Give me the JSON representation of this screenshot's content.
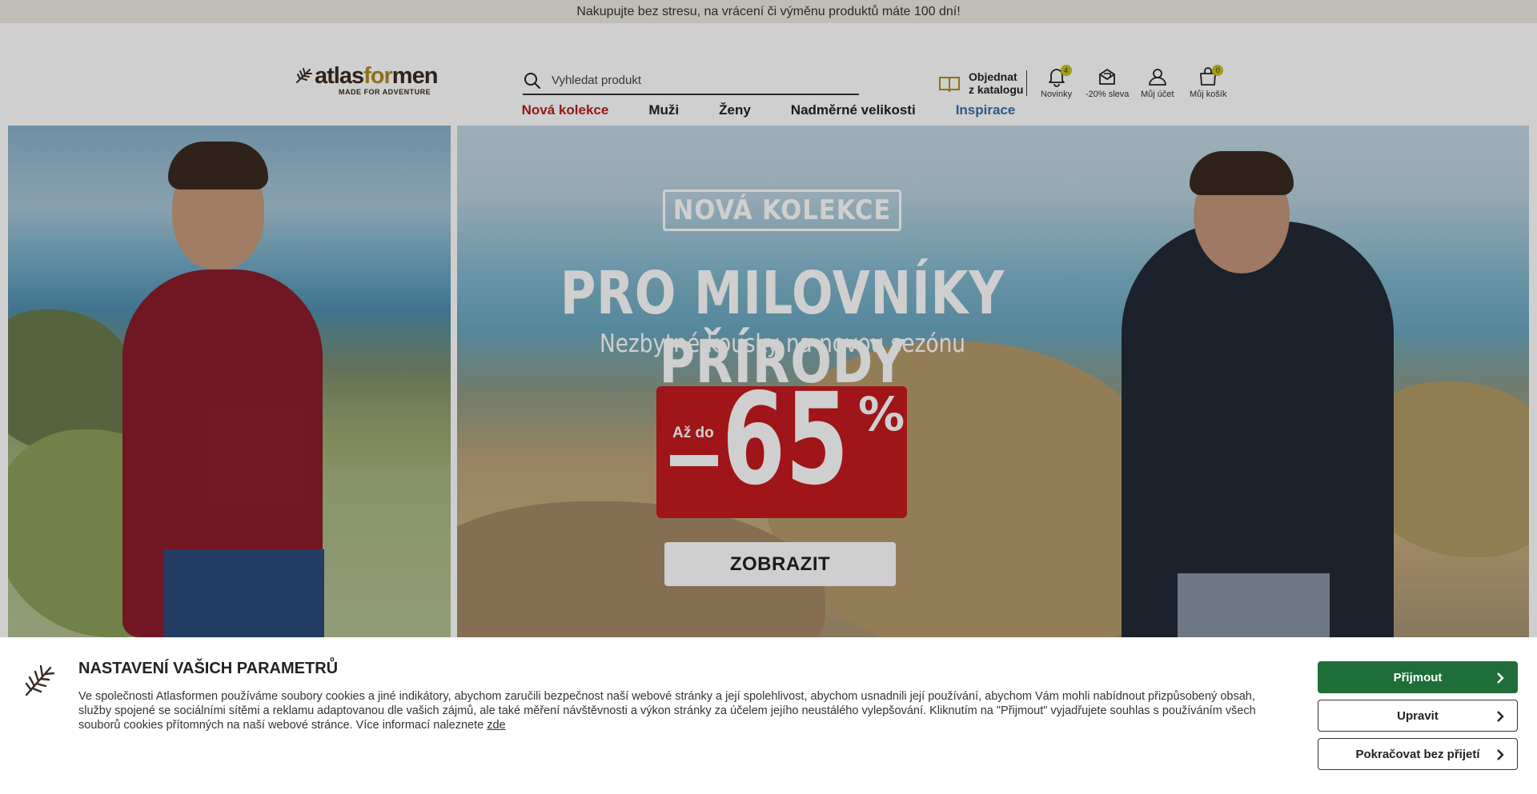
{
  "announcement": "Nakupujte bez stresu, na vrácení či výměnu produktů máte 100 dní!",
  "logo": {
    "brand_a": "atlas",
    "brand_b": "for",
    "brand_c": "men",
    "tagline": "MADE FOR ADVENTURE"
  },
  "search": {
    "placeholder": "Vyhledat produkt"
  },
  "catalog": {
    "line1": "Objednat",
    "line2": "z katalogu"
  },
  "header_icons": [
    {
      "icon": "bell-icon",
      "label": "Novinky",
      "badge": "4"
    },
    {
      "icon": "gift-icon",
      "label": "-20% sleva"
    },
    {
      "icon": "user-icon",
      "label": "Můj účet"
    },
    {
      "icon": "bag-icon",
      "label": "Můj košík",
      "badge": "0"
    }
  ],
  "nav": {
    "items": [
      {
        "label": "Nová kolekce",
        "color": "#b21e1e"
      },
      {
        "label": "Muži",
        "color": "#222222"
      },
      {
        "label": "Ženy",
        "color": "#222222"
      },
      {
        "label": "Nadměrné velikosti",
        "color": "#222222"
      },
      {
        "label": "Inspirace",
        "color": "#3a6aa8"
      }
    ]
  },
  "hero": {
    "badge": "NOVÁ KOLEKCE",
    "title": "PRO MILOVNÍKY PŘÍRODY",
    "subtitle": "Nezbytné kousky na novou sezónu",
    "promo_prefix": "Až do",
    "promo_value": "65",
    "promo_percent": "%",
    "cta": "ZOBRAZIT"
  },
  "cookie": {
    "title": "NASTAVENÍ VAŠICH PARAMETRŮ",
    "text": "Ve společnosti Atlasformen používáme soubory cookies a jiné indikátory, abychom zaručili bezpečnost naší webové stránky a její spolehlivost, abychom usnadnili její používání, abychom Vám mohli nabídnout přizpůsobený obsah, služby spojené se sociálními sítěmi a reklamu adaptovanou dle vašich zájmů, ale také měření návštěvnosti a výkon stránky za účelem jejího neustálého vylepšování. Kliknutím na \"Přijmout\" vyjadřujete souhlas s používáním všech souborů cookies přítomných na naší webové stránce. Více informací naleznete ",
    "link": "zde",
    "accept": "Přijmout",
    "edit": "Upravit",
    "continue": "Pokračovat bez přijetí"
  },
  "colors": {
    "accept": "#1f6e3a",
    "promo": "#c41a1f",
    "badge": "#c8c21a",
    "brand_accent": "#b18a23"
  }
}
